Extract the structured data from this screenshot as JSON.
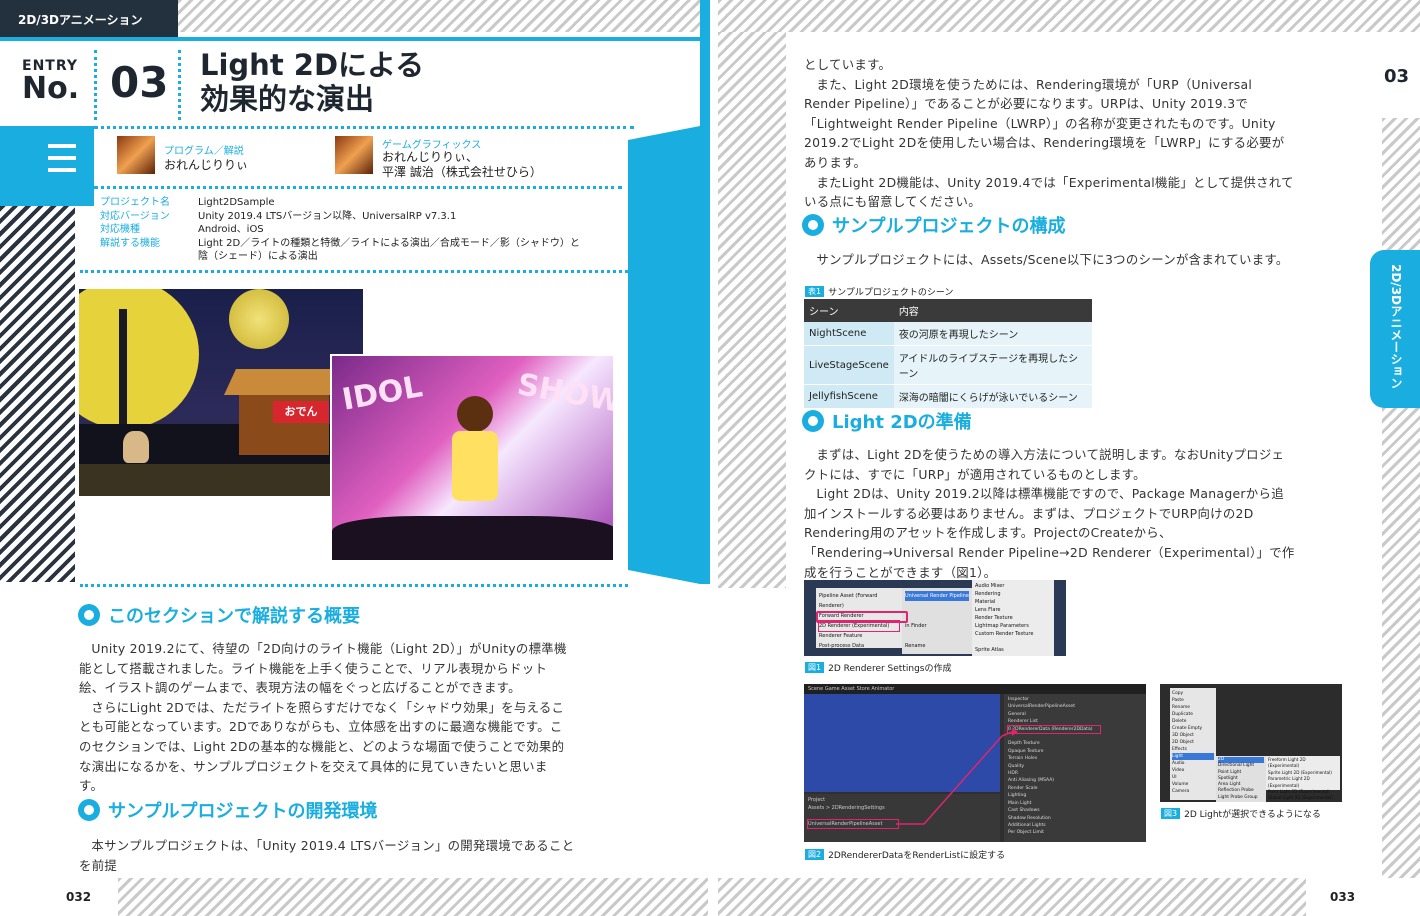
{
  "header": {
    "category": "2D/3Dアニメーション"
  },
  "entry": {
    "word": "ENTRY",
    "no": "No.",
    "number": "03"
  },
  "title": {
    "line1": "Light 2Dによる",
    "line2": "効果的な演出"
  },
  "authors": {
    "program_role": "プログラム／解説",
    "program_name": "おれんじりりぃ",
    "graphics_role": "ゲームグラフィックス",
    "graphics_name1": "おれんじりりぃ、",
    "graphics_name2": "平澤 誠治（株式会社せひら）"
  },
  "meta": [
    {
      "k": "プロジェクト名",
      "v": "Light2DSample"
    },
    {
      "k": "対応バージョン",
      "v": "Unity 2019.4 LTSバージョン以降、UniversalRP v7.3.1"
    },
    {
      "k": "対応機種",
      "v": "Android、iOS"
    },
    {
      "k": "解説する機能",
      "v": "Light 2D／ライトの種類と特徴／ライトによる演出／合成モード／影（シャドウ）と",
      "v2": "陰（シェード）による演出"
    }
  ],
  "art": {
    "stall_sign": "おでん",
    "show_text1": "IDOL",
    "show_text2": "SHOW"
  },
  "left_sections": {
    "s1_title": "このセクションで解説する概要",
    "s1_p1": "Unity 2019.2にて、待望の「2D向けのライト機能（Light 2D）」がUnityの標準機能として搭載されました。ライト機能を上手く使うことで、リアル表現からドット絵、イラスト調のゲームまで、表現方法の幅をぐっと広げることができます。",
    "s1_p2": "さらにLight 2Dでは、ただライトを照らすだけでなく「シャドウ効果」を与えることも可能となっています。2Dでありながらも、立体感を出すのに最適な機能です。このセクションでは、Light 2Dの基本的な機能と、どのような場面で使うことで効果的な演出になるかを、サンプルプロジェクトを交えて具体的に見ていきたいと思います。",
    "s2_title": "サンプルプロジェクトの開発環境",
    "s2_p1": "本サンプルプロジェクトは、「Unity 2019.4 LTSバージョン」の開発環境であることを前提"
  },
  "right_text": {
    "p0": "としています。",
    "p1": "また、Light 2D環境を使うためには、Rendering環境が「URP（Universal Render Pipeline）」であることが必要になります。URPは、Unity 2019.3で「Lightweight Render Pipeline（LWRP）」の名称が変更されたものです。Unity 2019.2でLight 2Dを使用したい場合は、Rendering環境を「LWRP」にする必要があります。",
    "p2": "またLight 2D機能は、Unity 2019.4では「Experimental機能」として提供されている点にも留意してください。",
    "s3_title": "サンプルプロジェクトの構成",
    "s3_p1": "サンプルプロジェクトには、Assets/Scene以下に3つのシーンが含まれています。",
    "s4_title": "Light 2Dの準備",
    "s4_p1": "まずは、Light 2Dを使うための導入方法について説明します。なおUnityプロジェクトには、すでに「URP」が適用されているものとします。",
    "s4_p2": "Light 2Dは、Unity 2019.2以降は標準機能ですので、Package Managerから追加インストールする必要はありません。まずは、プロジェクトでURP向けの2D Rendering用のアセットを作成します。ProjectのCreateから、「Rendering→Universal Render Pipeline→2D Renderer（Experimental）」で作成を行うことができます（図1）。"
  },
  "table": {
    "tag": "表1",
    "caption": "サンプルプロジェクトのシーン",
    "headers": [
      "シーン",
      "内容"
    ],
    "rows": [
      [
        "NightScene",
        "夜の河原を再現したシーン"
      ],
      [
        "LiveStageScene",
        "アイドルのライブステージを再現したシーン"
      ],
      [
        "JellyfishScene",
        "深海の暗闇にくらげが泳いでいるシーン"
      ]
    ]
  },
  "figures": {
    "f1_tag": "図1",
    "f1_caption": "2D Renderer Settingsの作成",
    "f2_tag": "図2",
    "f2_caption": "2DRendererDataをRenderListに設定する",
    "f3_tag": "図3",
    "f3_caption": "2D Lightが選択できるようになる"
  },
  "fig1_menu": {
    "left": [
      "Pipeline Asset (Forward Renderer)",
      "Forward Renderer",
      "2D Renderer (Experimental)",
      "Renderer Feature",
      "Post-process Data"
    ],
    "mid": [
      "Universal Render Pipeline",
      "",
      "",
      "in Finder",
      "",
      "Rename"
    ],
    "right": [
      "Audio Mixer",
      "Rendering",
      "Material",
      "Lens Flare",
      "Render Texture",
      "Lightmap Parameters",
      "Custom Render Texture",
      "",
      "Sprite Atlas"
    ]
  },
  "fig2_ui": {
    "tabs": "Scene  Game  Asset Store  Animator",
    "inspector": "Inspector",
    "asset_name": "UniversalRenderPipelineAsset",
    "section_general": "General",
    "renderer_list": "Renderer List",
    "renderer_item": "0  2DRendererData (Renderer2DData)",
    "rows": [
      "Depth Texture",
      "Opaque Texture",
      "Terrain Holes",
      "Quality",
      "HDR",
      "Anti Aliasing (MSAA)",
      "Render Scale",
      "Lighting",
      "Main Light",
      "Cast Shadows",
      "Shadow Resolution",
      "Additional Lights",
      "Per Object Limit"
    ],
    "project": "Project",
    "assets": "Assets > 2DRenderingSettings",
    "asset_item": "UniversalRenderPipelineAsset"
  },
  "fig3_menu": {
    "left": [
      "Copy",
      "Paste",
      "Rename",
      "Duplicate",
      "Delete",
      "Create Empty",
      "3D Object",
      "2D Object",
      "Effects",
      "Light",
      "Audio",
      "Video",
      "UI",
      "Volume",
      "Camera"
    ],
    "mid": [
      "2D",
      "Directional Light",
      "Point Light",
      "Spotlight",
      "Area Light",
      "Reflection Probe",
      "Light Probe Group"
    ],
    "right": [
      "Freeform Light 2D (Experimental)",
      "Sprite Light 2D (Experimental)",
      "Parametric Light 2D (Experimental)",
      "Point Light 2D (Experimental)",
      "Global Light 2D (Experimental)"
    ]
  },
  "side": {
    "number": "03",
    "tab_label": "2D/3Dアニメーション"
  },
  "footer": {
    "left_page": "032",
    "right_page": "033"
  }
}
